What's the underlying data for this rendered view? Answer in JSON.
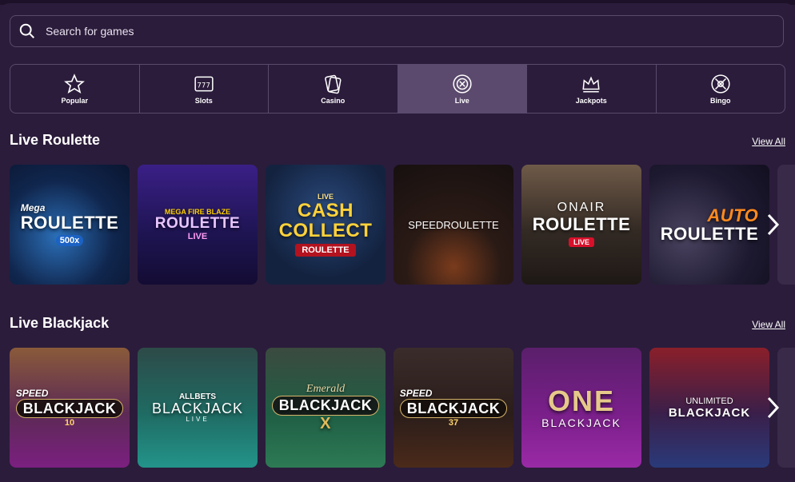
{
  "search": {
    "placeholder": "Search for games"
  },
  "categories": [
    {
      "label": "Popular",
      "icon": "star-icon"
    },
    {
      "label": "Slots",
      "icon": "slot-machine-icon"
    },
    {
      "label": "Casino",
      "icon": "cards-icon"
    },
    {
      "label": "Live",
      "icon": "roulette-chip-icon",
      "active": true
    },
    {
      "label": "Jackpots",
      "icon": "crown-icon"
    },
    {
      "label": "Bingo",
      "icon": "bingo-ball-icon"
    }
  ],
  "sections": [
    {
      "title": "Live Roulette",
      "view_all": "View All",
      "tiles": [
        {
          "top": "Mega",
          "main": "ROULETTE",
          "sub": "500x"
        },
        {
          "top": "MEGA FIRE BLAZE",
          "main": "ROULETTE",
          "sub": "LIVE"
        },
        {
          "top": "LIVE",
          "main": "CASH COLLECT",
          "sub": "ROULETTE"
        },
        {
          "top": "",
          "main": "SPEEDROULETTE",
          "sub": ""
        },
        {
          "top": "ONAIR",
          "main": "ROULETTE",
          "sub": "LIVE"
        },
        {
          "top": "AUTO",
          "main": "ROULETTE",
          "sub": ""
        }
      ]
    },
    {
      "title": "Live Blackjack",
      "view_all": "View All",
      "tiles": [
        {
          "top": "SPEED",
          "main": "BLACKJACK",
          "sub": "10"
        },
        {
          "top": "ALLBETS",
          "main": "BLACKJACK",
          "sub": "LIVE"
        },
        {
          "top": "Emerald",
          "main": "BLACKJACK",
          "sub": "X"
        },
        {
          "top": "SPEED",
          "main": "BLACKJACK",
          "sub": "37"
        },
        {
          "top": "ONE",
          "main": "BLACKJACK",
          "sub": ""
        },
        {
          "top": "UNLIMITED",
          "main": "BLACKJACK",
          "sub": ""
        }
      ]
    }
  ],
  "colors": {
    "background": "#2b1c3b",
    "border": "#5a4a6c",
    "active_tab": "#5b4a6d",
    "live_badge": "#d8102a"
  }
}
